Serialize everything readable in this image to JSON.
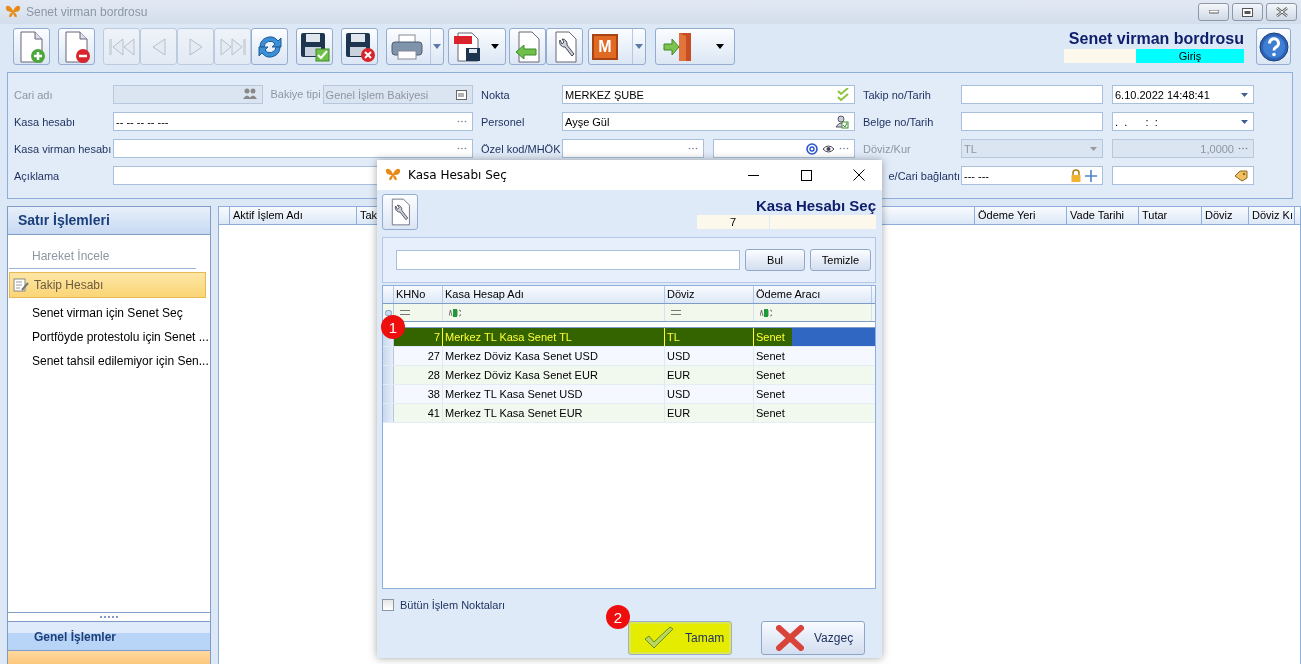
{
  "window": {
    "title": "Senet virman bordrosu"
  },
  "toolbar": [
    {
      "kind": "new",
      "disabled": false
    },
    {
      "kind": "delete",
      "disabled": false
    },
    {
      "kind": "first",
      "disabled": true
    },
    {
      "kind": "prev",
      "disabled": true
    },
    {
      "kind": "next",
      "disabled": true
    },
    {
      "kind": "last",
      "disabled": true
    },
    {
      "kind": "refresh",
      "disabled": false
    },
    {
      "kind": "save",
      "disabled": false
    },
    {
      "kind": "save-cancel",
      "disabled": false
    },
    {
      "kind": "print",
      "disabled": false,
      "dropdown": true
    },
    {
      "kind": "pdf",
      "disabled": false,
      "dropdown": true
    },
    {
      "kind": "import",
      "disabled": false
    },
    {
      "kind": "wrench",
      "disabled": false
    },
    {
      "kind": "letter",
      "text": "M",
      "disabled": false,
      "dropdown": true
    },
    {
      "kind": "exit",
      "disabled": false,
      "dropdown": true
    }
  ],
  "header": {
    "title": "Senet virman bordrosu",
    "status": "Giriş"
  },
  "form": {
    "rows": [
      {
        "groups": [
          {
            "label": "Cari adı",
            "disabled": true,
            "fields": [
              {
                "kind": "picker",
                "disabled": true
              },
              {
                "kind": "label",
                "value": "Bakiye tipi",
                "disabled": true
              },
              {
                "kind": "list",
                "value": "Genel İşlem Bakiyesi",
                "disabled": true
              }
            ]
          },
          {
            "label": "Nokta",
            "disabled": false,
            "fields": [
              {
                "kind": "verified",
                "value": "MERKEZ ŞUBE",
                "disabled": false
              }
            ]
          },
          {
            "label": "Takip no/Tarih",
            "disabled": false,
            "fields": [
              {
                "kind": "text",
                "disabled": false
              },
              {
                "kind": "date",
                "value": "6.10.2022 14:48:41",
                "disabled": false
              }
            ]
          }
        ]
      },
      {
        "groups": [
          {
            "label": "Kasa hesabı",
            "disabled": false,
            "fields": [
              {
                "kind": "lookup",
                "value": "-- -- -- -- ---",
                "disabled": false
              }
            ]
          },
          {
            "label": "Personel",
            "disabled": false,
            "fields": [
              {
                "kind": "person",
                "value": "Ayşe Gül",
                "disabled": false
              }
            ]
          },
          {
            "label": "Belge no/Tarih",
            "disabled": false,
            "fields": [
              {
                "kind": "text",
                "disabled": false
              },
              {
                "kind": "date",
                "value": ".  .      :  :",
                "disabled": false
              }
            ]
          }
        ]
      },
      {
        "groups": [
          {
            "label": "Kasa virman hesabı",
            "disabled": false,
            "fields": [
              {
                "kind": "lookup",
                "disabled": false
              }
            ]
          },
          {
            "label": "Özel kod/MHÖK",
            "disabled": false,
            "fields": [
              {
                "kind": "lookup",
                "disabled": false
              },
              {
                "kind": "email",
                "disabled": false
              }
            ]
          },
          {
            "label": "Döviz/Kur",
            "disabled": true,
            "fields": [
              {
                "kind": "combo",
                "value": "TL",
                "disabled": true
              },
              {
                "kind": "number",
                "value": "1,0000",
                "disabled": true
              }
            ]
          }
        ]
      },
      {
        "groups": [
          {
            "label": "Açıklama",
            "disabled": false,
            "fields": [
              {
                "kind": "text",
                "disabled": false
              }
            ]
          },
          {
            "label": "e/Cari bağlantı",
            "disabled": false,
            "fields": [
              {
                "kind": "lock-add",
                "value": "--- ---",
                "disabled": false
              },
              {
                "kind": "tag",
                "disabled": false
              }
            ]
          }
        ]
      }
    ]
  },
  "sidebar": {
    "title": "Satır İşlemleri",
    "items": [
      {
        "label": "Hareket İncele",
        "disabled": true,
        "selected": false
      },
      {
        "label": "Takip Hesabı",
        "disabled": false,
        "selected": true
      },
      {
        "label": "Senet virman için Senet Seç",
        "disabled": false,
        "selected": false
      },
      {
        "label": "Portföyde protestolu için Senet ...",
        "disabled": false,
        "selected": false
      },
      {
        "label": "Senet tahsil edilemiyor için Sen...",
        "disabled": false,
        "selected": false
      }
    ],
    "footer": "Genel İşlemler"
  },
  "grid": {
    "columns": [
      "Aktif İşlem Adı",
      "Tak",
      "Ödeme Yeri",
      "Vade Tarihi",
      "Tutar",
      "Döviz",
      "Döviz Kı"
    ]
  },
  "dialog": {
    "title": "Kasa Hesabı Seç",
    "heading": "Kasa Hesabı Seç",
    "code": "7",
    "search": {
      "buttons": [
        "Bul",
        "Temizle"
      ]
    },
    "table": {
      "columns": [
        "KHNo",
        "Kasa Hesap Adı",
        "Döviz",
        "Ödeme Aracı"
      ],
      "filters": [
        {
          "kind": "equals"
        },
        {
          "kind": "contains"
        },
        {
          "kind": "equals"
        },
        {
          "kind": "contains"
        }
      ],
      "rows": [
        {
          "no": "7",
          "name": "Merkez TL Kasa Senet TL",
          "currency": "TL",
          "method": "Senet",
          "selected": true
        },
        {
          "no": "27",
          "name": "Merkez Döviz Kasa Senet USD",
          "currency": "USD",
          "method": "Senet",
          "selected": false
        },
        {
          "no": "28",
          "name": "Merkez Döviz Kasa Senet EUR",
          "currency": "EUR",
          "method": "Senet",
          "selected": false
        },
        {
          "no": "38",
          "name": "Merkez TL Kasa Senet USD",
          "currency": "USD",
          "method": "Senet",
          "selected": false
        },
        {
          "no": "41",
          "name": "Merkez TL Kasa Senet EUR",
          "currency": "EUR",
          "method": "Senet",
          "selected": false
        }
      ]
    },
    "all_points": {
      "label": "Bütün İşlem Noktaları",
      "checked": false
    },
    "buttons": [
      {
        "label": "Tamam",
        "kind": "ok",
        "highlighted": true
      },
      {
        "label": "Vazgeç",
        "kind": "cancel",
        "highlighted": false
      }
    ]
  },
  "callouts": [
    "1",
    "2"
  ]
}
